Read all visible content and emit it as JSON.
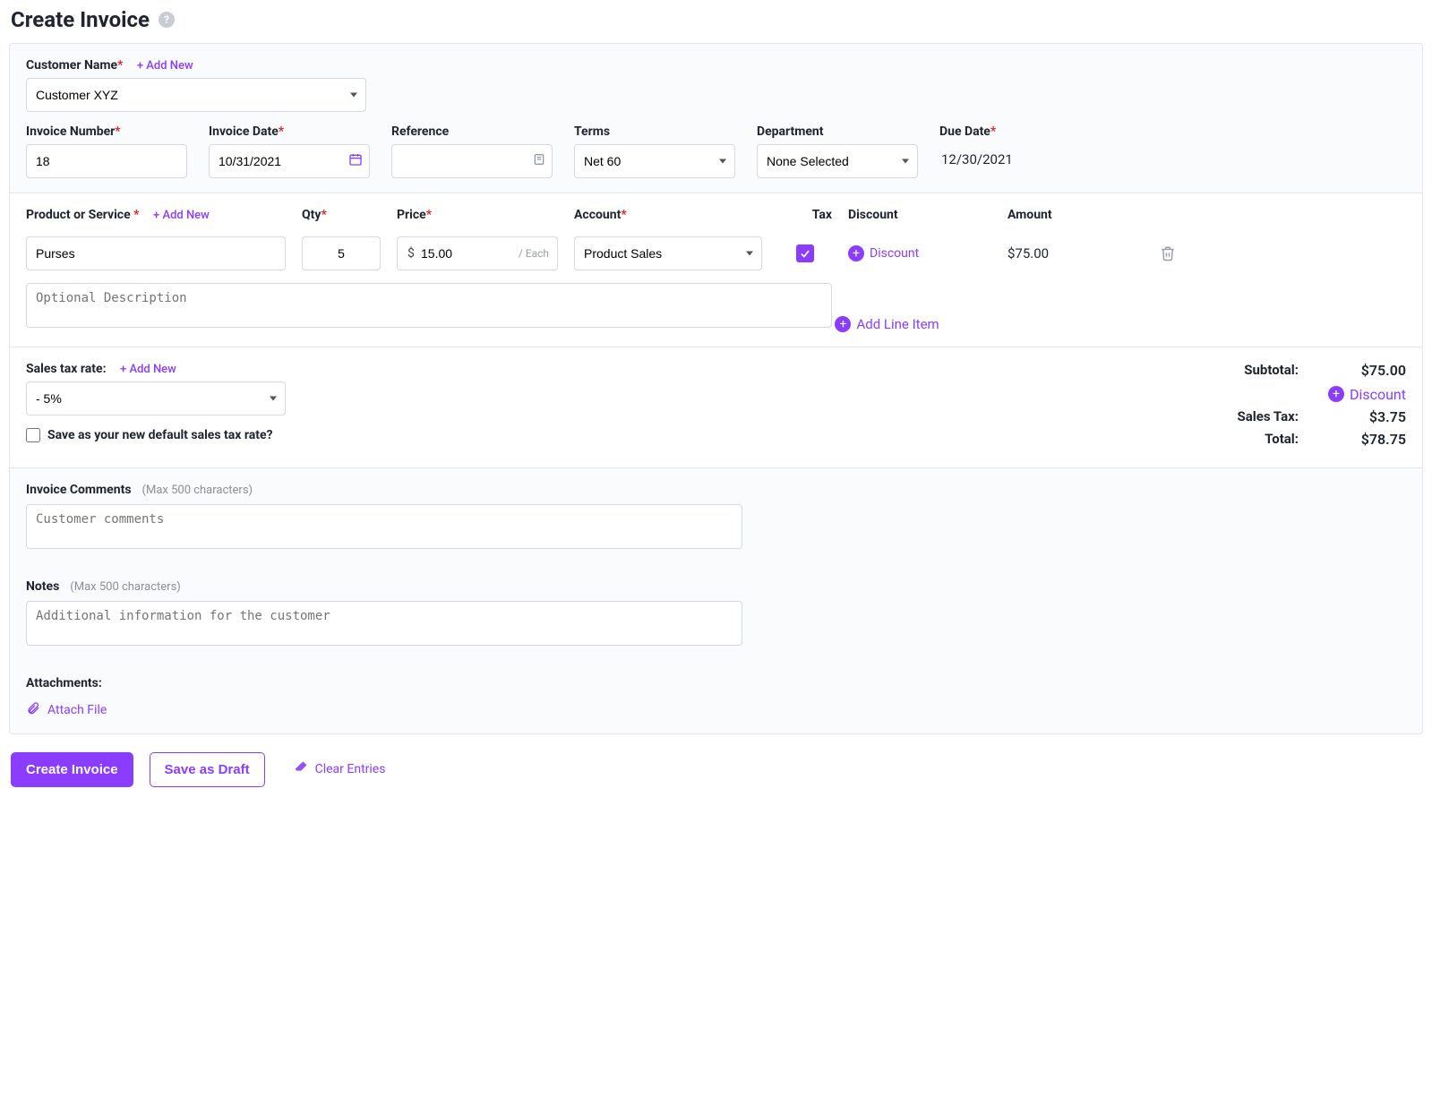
{
  "page": {
    "title": "Create Invoice"
  },
  "customer": {
    "label": "Customer Name",
    "add_new_label": "+ Add New",
    "value": "Customer XYZ"
  },
  "fields": {
    "invoice_number": {
      "label": "Invoice Number",
      "value": "18"
    },
    "invoice_date": {
      "label": "Invoice Date",
      "value": "10/31/2021"
    },
    "reference": {
      "label": "Reference",
      "value": ""
    },
    "terms": {
      "label": "Terms",
      "value": "Net 60"
    },
    "department": {
      "label": "Department",
      "value": "None Selected"
    },
    "due_date": {
      "label": "Due Date",
      "value": "12/30/2021"
    }
  },
  "line_headers": {
    "product": "Product or Service",
    "product_add_new": "+ Add New",
    "qty": "Qty",
    "price": "Price",
    "account": "Account",
    "tax": "Tax",
    "discount": "Discount",
    "amount": "Amount"
  },
  "line_item": {
    "product": "Purses",
    "qty": "5",
    "price": "15.00",
    "price_unit": "/ Each",
    "account": "Product Sales",
    "tax_checked": true,
    "discount_label": "Discount",
    "amount": "$75.00",
    "description_placeholder": "Optional Description"
  },
  "add_line_label": "Add Line Item",
  "tax": {
    "label": "Sales tax rate:",
    "add_new_label": "+ Add New",
    "value": "- 5%",
    "save_default_label": "Save as your new default sales tax rate?"
  },
  "totals": {
    "subtotal_label": "Subtotal:",
    "subtotal_value": "$75.00",
    "discount_label": "Discount",
    "salestax_label": "Sales Tax:",
    "salestax_value": "$3.75",
    "total_label": "Total:",
    "total_value": "$78.75"
  },
  "comments": {
    "heading": "Invoice Comments",
    "hint": "(Max 500 characters)",
    "placeholder": "Customer comments"
  },
  "notes": {
    "heading": "Notes",
    "hint": "(Max 500 characters)",
    "placeholder": "Additional information for the customer"
  },
  "attachments": {
    "heading": "Attachments:",
    "attach_label": "Attach File"
  },
  "buttons": {
    "create": "Create Invoice",
    "draft": "Save as Draft",
    "clear": "Clear Entries"
  }
}
